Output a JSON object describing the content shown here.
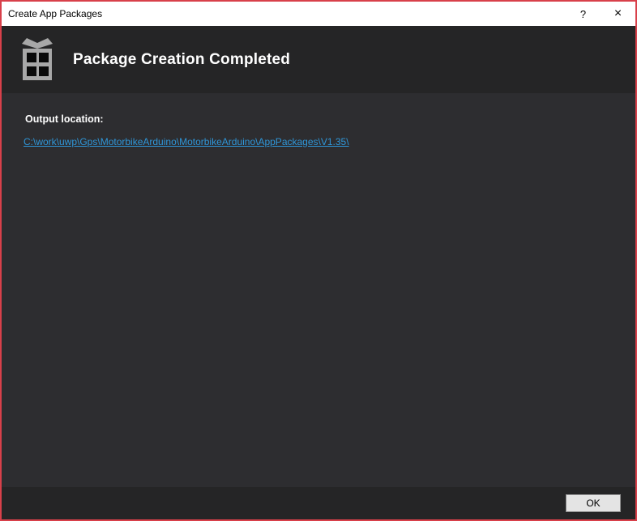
{
  "window": {
    "title": "Create App Packages",
    "help_glyph": "?",
    "close_glyph": "×",
    "border_color": "#D8404A",
    "titlebar_bg": "#FFFFFF",
    "header_bg": "#252526",
    "body_bg": "#2D2D30",
    "footer_bg": "#252526",
    "link_color": "#2F96D8"
  },
  "header": {
    "title": "Package Creation Completed",
    "icon": "package-gift-icon"
  },
  "body": {
    "output_location_label": "Output location:",
    "output_location_link": "C:\\work\\uwp\\Gps\\MotorbikeArduino\\MotorbikeArduino\\AppPackages\\V1.35\\"
  },
  "footer": {
    "ok_label": "OK"
  }
}
